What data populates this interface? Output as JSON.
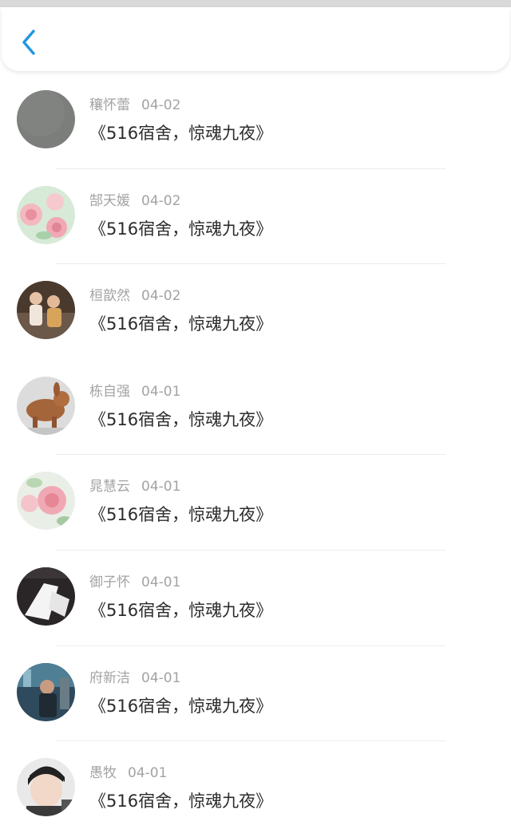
{
  "header": {
    "back_icon": "chevron-left-icon",
    "accent_color": "#2196e3"
  },
  "list": {
    "items": [
      {
        "name": "穰怀蕾",
        "date": "04-02",
        "title": "《516宿舍，惊魂九夜》"
      },
      {
        "name": "郜天媛",
        "date": "04-02",
        "title": "《516宿舍，惊魂九夜》"
      },
      {
        "name": "桓歆然",
        "date": "04-02",
        "title": "《516宿舍，惊魂九夜》"
      },
      {
        "name": "栋自强",
        "date": "04-01",
        "title": "《516宿舍，惊魂九夜》"
      },
      {
        "name": "晁慧云",
        "date": "04-01",
        "title": "《516宿舍，惊魂九夜》"
      },
      {
        "name": "御子怀",
        "date": "04-01",
        "title": "《516宿舍，惊魂九夜》"
      },
      {
        "name": "府新洁",
        "date": "04-01",
        "title": "《516宿舍，惊魂九夜》"
      },
      {
        "name": "愚牧",
        "date": "04-01",
        "title": "《516宿舍，惊魂九夜》"
      }
    ]
  }
}
